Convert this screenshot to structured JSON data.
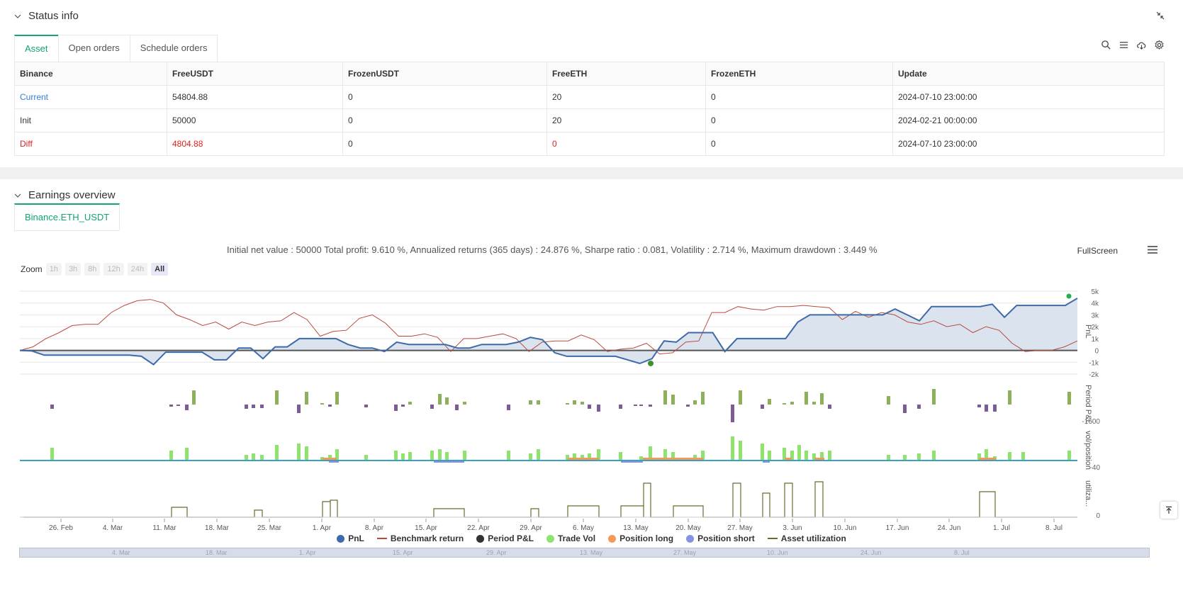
{
  "status": {
    "title": "Status info",
    "tabs": [
      "Asset",
      "Open orders",
      "Schedule orders"
    ],
    "table": {
      "headers": [
        "Binance",
        "FreeUSDT",
        "FrozenUSDT",
        "FreeETH",
        "FrozenETH",
        "Update"
      ],
      "rows": [
        [
          "Current",
          "54804.88",
          "0",
          "20",
          "0",
          "2024-07-10 23:00:00"
        ],
        [
          "Init",
          "50000",
          "0",
          "20",
          "0",
          "2024-02-21 00:00:00"
        ],
        [
          "Diff",
          "4804.88",
          "0",
          "0",
          "0",
          "2024-07-10 23:00:00"
        ]
      ]
    }
  },
  "earnings": {
    "title": "Earnings overview",
    "tab": "Binance.ETH_USDT",
    "summary": "Initial net value : 50000 Total profit: 9.610 %, Annualized returns (365 days) : 24.876 %, Sharpe ratio : 0.081, Volatility : 2.714 %, Maximum drawdown : 3.449 %",
    "fullscreen": "FullScreen",
    "zoom_label": "Zoom",
    "zoom_buttons": [
      "1h",
      "3h",
      "8h",
      "12h",
      "24h",
      "All"
    ]
  },
  "chart_data": {
    "type": "line",
    "x_ticks": [
      "26. Feb",
      "4. Mar",
      "11. Mar",
      "18. Mar",
      "25. Mar",
      "1. Apr",
      "8. Apr",
      "15. Apr",
      "22. Apr",
      "29. Apr",
      "6. May",
      "13. May",
      "20. May",
      "27. May",
      "3. Jun",
      "10. Jun",
      "17. Jun",
      "24. Jun",
      "1. Jul",
      "8. Jul"
    ],
    "pnl_axis": {
      "label": "PnL",
      "ticks": [
        "5k",
        "4k",
        "3k",
        "2k",
        "1k",
        "0",
        "-1k",
        "-2k"
      ],
      "ylim": [
        -2000,
        5000
      ]
    },
    "period_axis": {
      "label": "Period P&L",
      "ticks": [
        "-1600"
      ]
    },
    "vol_axis": {
      "label": "vol/position",
      "ticks": [
        "-40"
      ]
    },
    "util_axis": {
      "label": "utiliza...",
      "ticks": [
        "0"
      ]
    },
    "pnl": [
      0,
      -50,
      -400,
      -400,
      -400,
      -400,
      -400,
      -400,
      -400,
      -400,
      -500,
      -1200,
      -150,
      -150,
      -150,
      -150,
      -800,
      -800,
      200,
      200,
      -700,
      300,
      300,
      1000,
      1000,
      1000,
      1000,
      500,
      200,
      200,
      -100,
      700,
      500,
      500,
      500,
      500,
      200,
      200,
      500,
      500,
      500,
      700,
      1100,
      900,
      -200,
      -500,
      -500,
      -500,
      -500,
      -500,
      -800,
      -1100,
      -700,
      800,
      700,
      1500,
      1500,
      1500,
      -100,
      1000,
      1000,
      1000,
      1000,
      1000,
      2400,
      3000,
      3000,
      3000,
      3000,
      3000,
      3000,
      3000,
      3500,
      3000,
      2500,
      3700,
      3700,
      3700,
      3700,
      3700,
      3900,
      2800,
      3800,
      3800,
      3800,
      3800,
      3800,
      4400
    ],
    "benchmark": [
      0,
      300,
      1000,
      1500,
      2100,
      2200,
      2200,
      3200,
      3800,
      4200,
      4300,
      4000,
      3000,
      2600,
      2100,
      2400,
      1800,
      2400,
      2100,
      2400,
      2500,
      3200,
      2600,
      1200,
      1600,
      1700,
      2700,
      3000,
      2300,
      1200,
      1200,
      1400,
      1100,
      -100,
      1000,
      1000,
      1200,
      1400,
      1000,
      -100,
      700,
      800,
      800,
      1300,
      900,
      -100,
      100,
      200,
      600,
      -300,
      -200,
      700,
      800,
      3200,
      3200,
      3700,
      3500,
      3400,
      3700,
      3700,
      3800,
      3700,
      3600,
      2600,
      3300,
      2800,
      3200,
      3000,
      2400,
      2200,
      2500,
      2000,
      2200,
      1500,
      2000,
      1700,
      600,
      -100,
      0,
      0,
      300,
      800
    ],
    "legend": [
      {
        "name": "PnL",
        "color": "#3d6aa8",
        "kind": "dot"
      },
      {
        "name": "Benchmark return",
        "color": "#b84a3f",
        "kind": "line"
      },
      {
        "name": "Period P&L",
        "color": "#333333",
        "kind": "dot"
      },
      {
        "name": "Trade Vol",
        "color": "#8de36c",
        "kind": "dot"
      },
      {
        "name": "Position long",
        "color": "#f39a57",
        "kind": "dot"
      },
      {
        "name": "Position short",
        "color": "#8793e0",
        "kind": "dot"
      },
      {
        "name": "Asset utilization",
        "color": "#6b6a2c",
        "kind": "line"
      }
    ],
    "navigator_ticks": [
      "4. Mar",
      "18. Mar",
      "1. Apr",
      "15. Apr",
      "29. Apr",
      "13. May",
      "27. May",
      "10. Jun",
      "24. Jun",
      "8. Jul"
    ]
  }
}
